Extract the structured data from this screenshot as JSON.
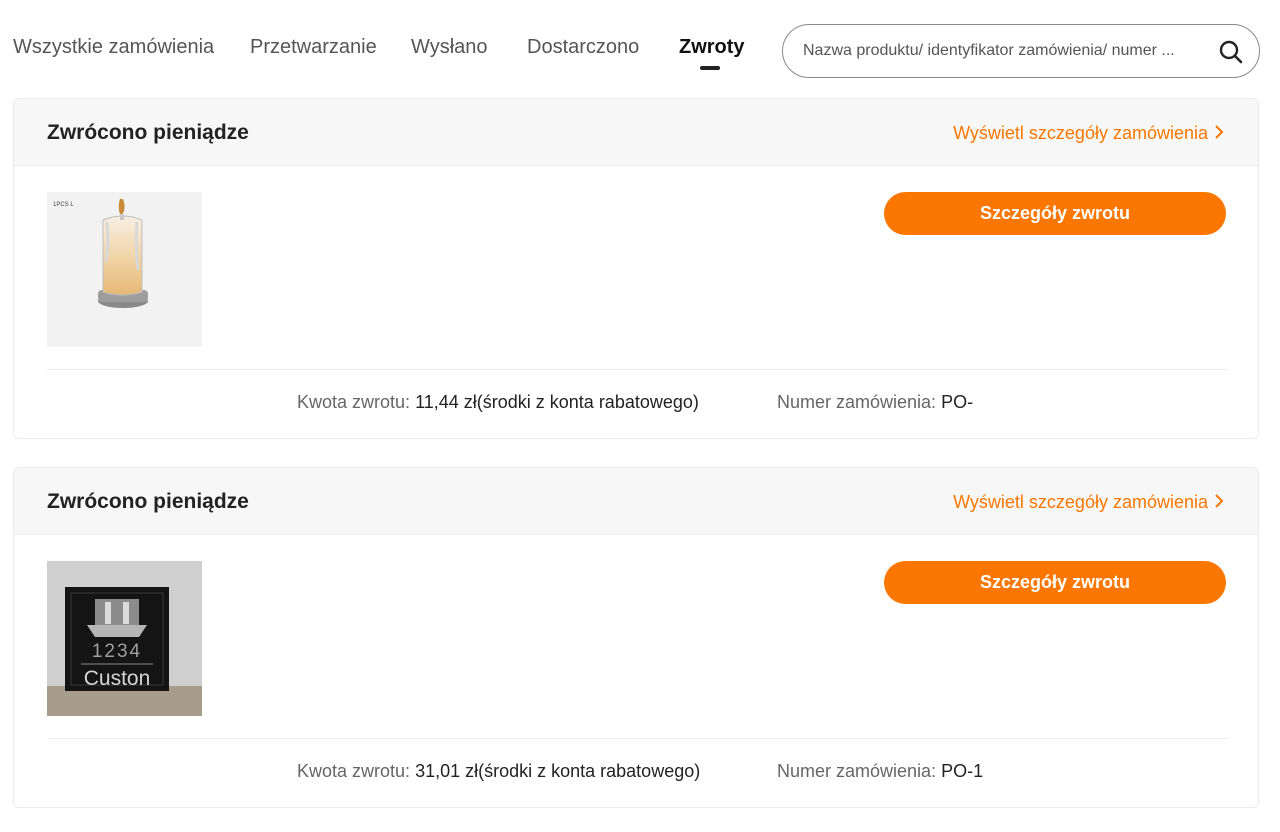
{
  "tabs": [
    {
      "label": "Wszystkie zamówienia",
      "active": false
    },
    {
      "label": "Przetwarzanie",
      "active": false
    },
    {
      "label": "Wysłano",
      "active": false
    },
    {
      "label": "Dostarczono",
      "active": false
    },
    {
      "label": "Zwroty",
      "active": true
    }
  ],
  "search": {
    "placeholder": "Nazwa produktu/ identyfikator zamówienia/ numer ...",
    "icon": "search-icon"
  },
  "colors": {
    "accent": "#fb7701",
    "header_bg": "#f7f7f7"
  },
  "orders": [
    {
      "status": "Zwrócono pieniądze",
      "details_link": "Wyświetl szczegóły zamówienia",
      "image": "candle-product-image",
      "image_text": "1PCS L",
      "action_label": "Szczegóły zwrotu",
      "refund_label": "Kwota zwrotu:",
      "refund_value": "11,44 zł(środki z konta rabatowego)",
      "order_label": "Numer zamówienia:",
      "order_value": "PO-"
    },
    {
      "status": "Zwrócono pieniądze",
      "details_link": "Wyświetl szczegóły zamówienia",
      "image": "address-plaque-product-image",
      "image_number": "1234",
      "image_text": "Custon",
      "action_label": "Szczegóły zwrotu",
      "refund_label": "Kwota zwrotu:",
      "refund_value": "31,01 zł(środki z konta rabatowego)",
      "order_label": "Numer zamówienia:",
      "order_value": "PO-1"
    }
  ]
}
